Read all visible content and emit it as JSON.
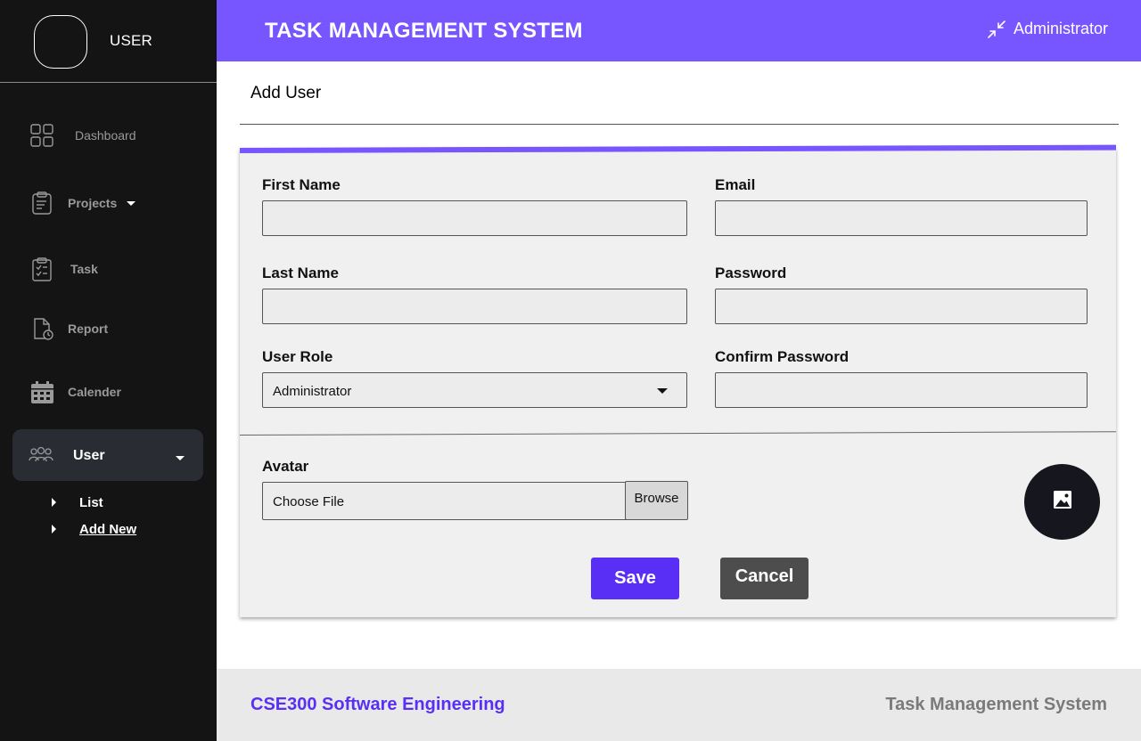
{
  "sidebar": {
    "username": "USER",
    "items": [
      {
        "label": "Dashboard",
        "icon": "dashboard-grid-icon"
      },
      {
        "label": "Projects",
        "icon": "clipboard-icon"
      },
      {
        "label": "Task",
        "icon": "checklist-icon"
      },
      {
        "label": "Report",
        "icon": "report-icon"
      },
      {
        "label": "Calender",
        "icon": "calendar-icon"
      },
      {
        "label": "User",
        "icon": "users-icon",
        "active": true
      }
    ],
    "user_subitems": [
      {
        "label": "List"
      },
      {
        "label": "Add New",
        "active": true
      }
    ]
  },
  "header": {
    "title": "TASK MANAGEMENT SYSTEM",
    "account": "Administrator"
  },
  "page": {
    "title": "Add User"
  },
  "form": {
    "first_name_label": "First Name",
    "first_name_value": "",
    "last_name_label": "Last Name",
    "last_name_value": "",
    "user_role_label": "User Role",
    "user_role_value": "Administrator",
    "email_label": "Email",
    "email_value": "",
    "password_label": "Password",
    "password_value": "",
    "confirm_password_label": "Confirm Password",
    "confirm_password_value": "",
    "avatar_label": "Avatar",
    "file_placeholder": "Choose File",
    "browse_label": "Browse",
    "save_label": "Save",
    "cancel_label": "Cancel"
  },
  "footer": {
    "left": "CSE300 Software Engineering",
    "right": "Task Management System"
  },
  "colors": {
    "accent": "#7755ff",
    "primary_button": "#5a2ff5",
    "sidebar_bg": "#141414",
    "active_nav_bg": "#2a2c33",
    "cancel_button": "#4d4d4d"
  }
}
